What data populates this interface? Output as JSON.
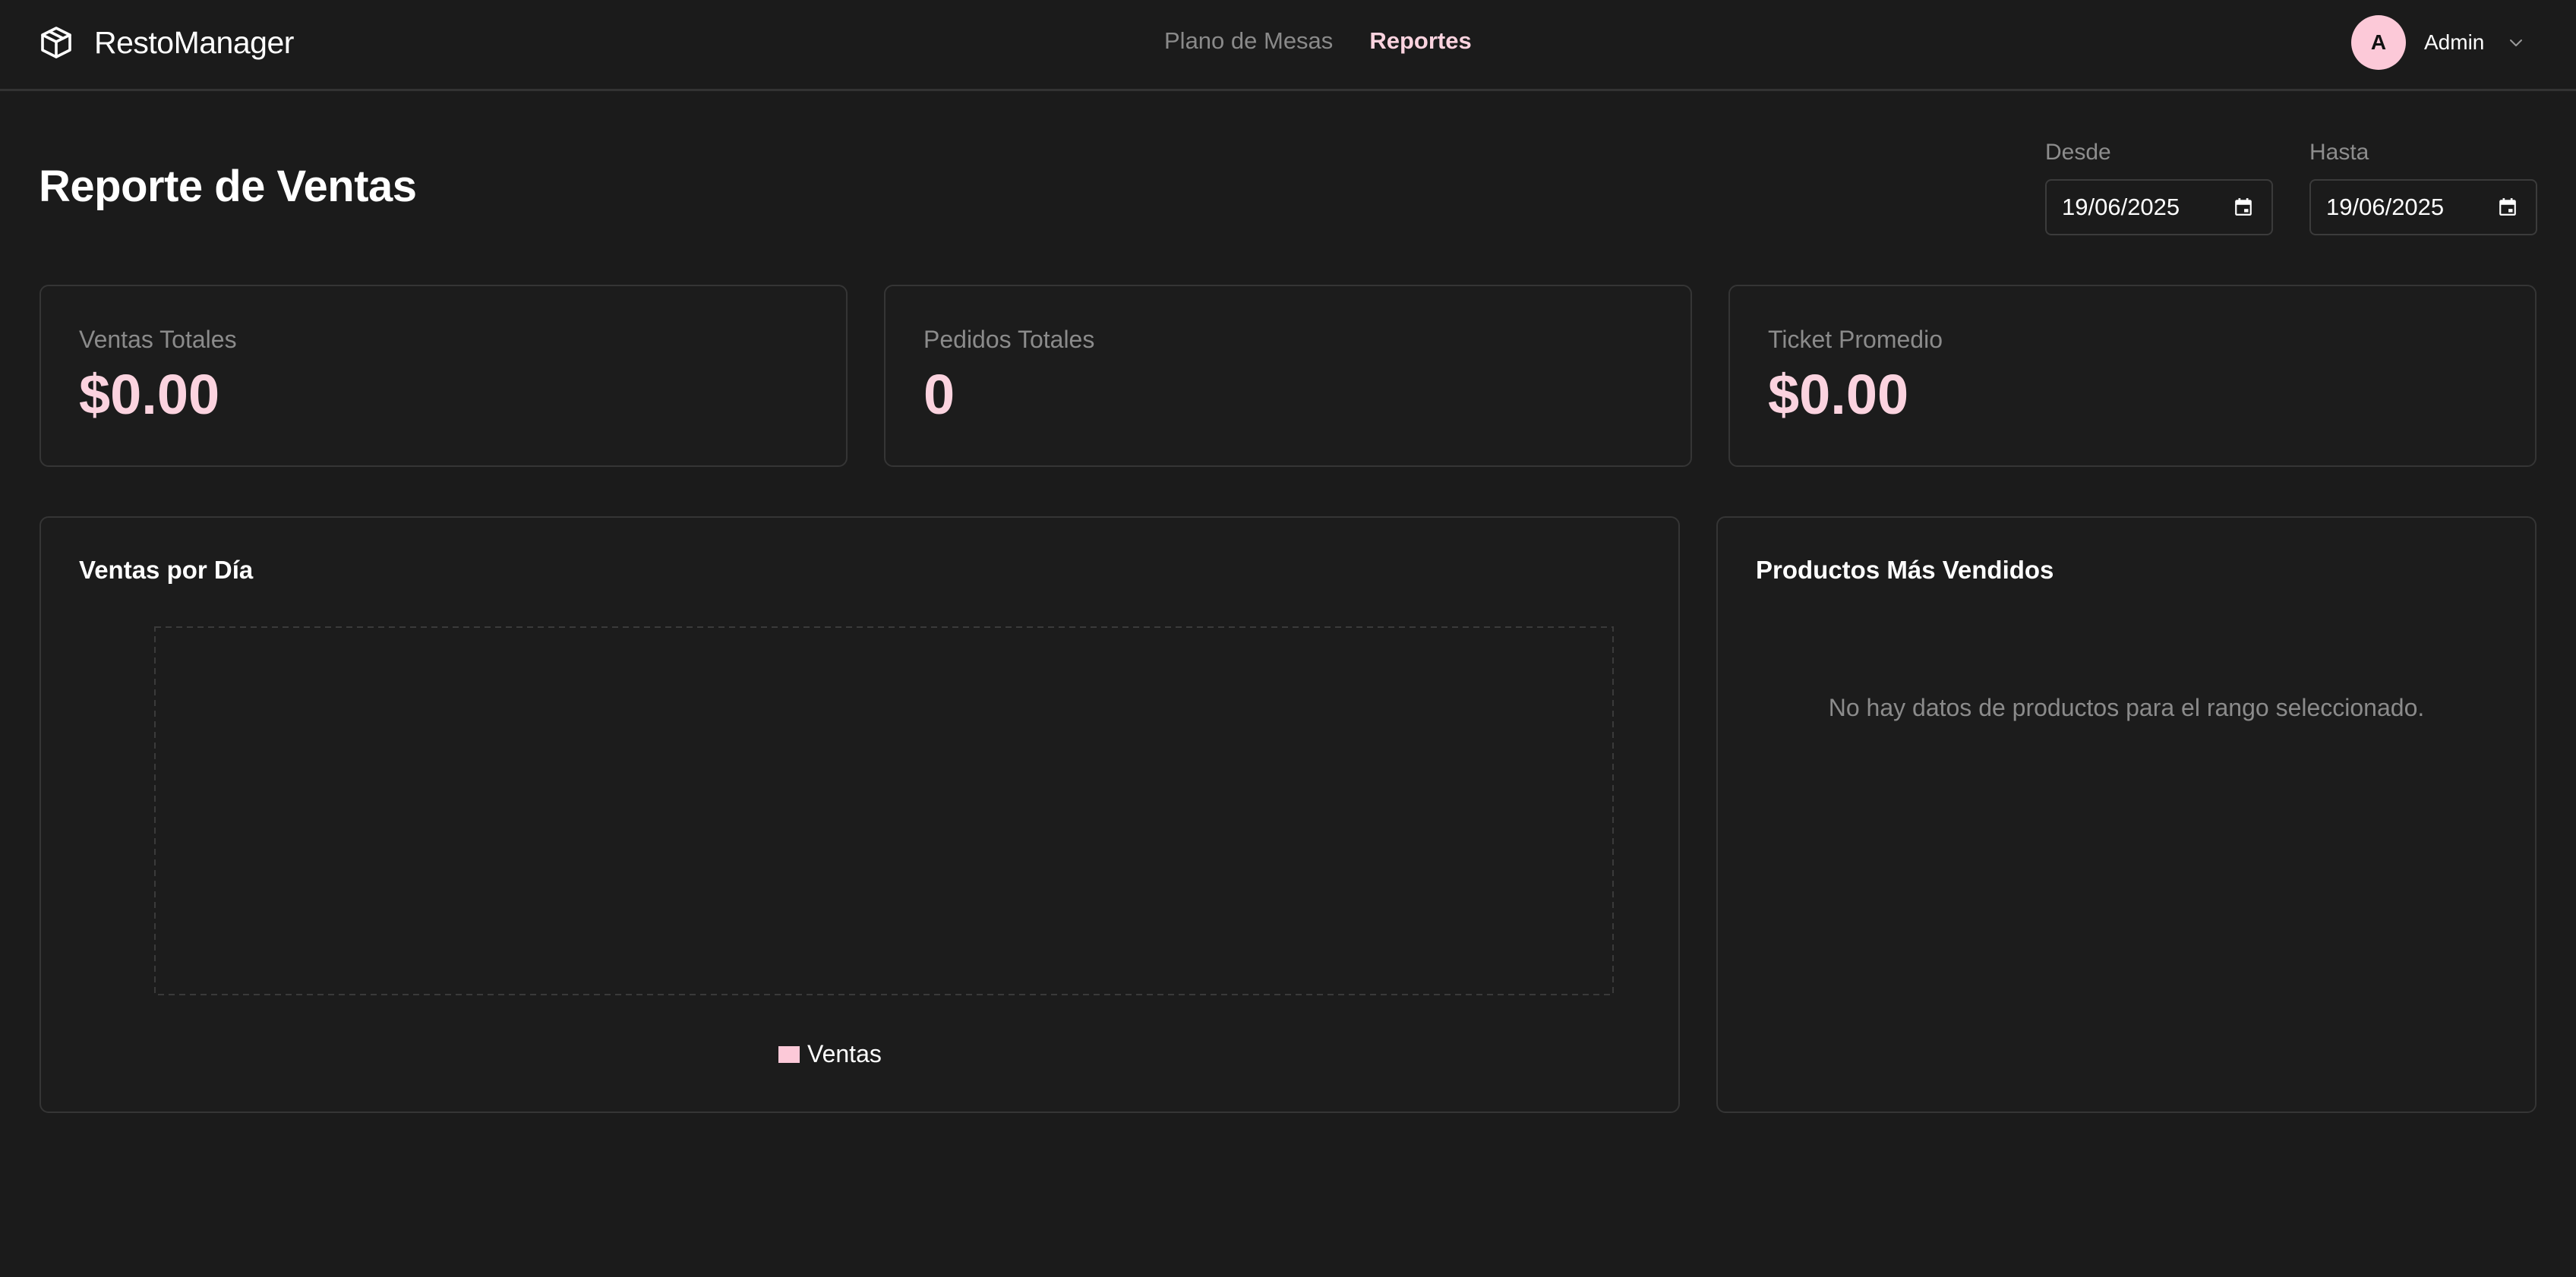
{
  "app": {
    "name": "RestoManager"
  },
  "nav": {
    "items": [
      {
        "label": "Plano de Mesas",
        "active": false
      },
      {
        "label": "Reportes",
        "active": true
      }
    ]
  },
  "user": {
    "initial": "A",
    "name": "Admin"
  },
  "page": {
    "title": "Reporte de Ventas"
  },
  "filters": {
    "from": {
      "label": "Desde",
      "value": "19/06/2025"
    },
    "to": {
      "label": "Hasta",
      "value": "19/06/2025"
    }
  },
  "stats": [
    {
      "label": "Ventas Totales",
      "value": "$0.00"
    },
    {
      "label": "Pedidos Totales",
      "value": "0"
    },
    {
      "label": "Ticket Promedio",
      "value": "$0.00"
    }
  ],
  "sales_chart": {
    "title": "Ventas por Día",
    "legend_label": "Ventas",
    "series_color": "#fcc9d8"
  },
  "chart_data": {
    "type": "bar",
    "title": "Ventas por Día",
    "categories": [],
    "series": [
      {
        "name": "Ventas",
        "values": []
      }
    ],
    "legend": "bottom",
    "grid": false
  },
  "top_products": {
    "title": "Productos Más Vendidos",
    "empty_message": "No hay datos de productos para el rango seleccionado."
  },
  "colors": {
    "accent": "#fbd3df",
    "background": "#1b1b1b",
    "border": "#353535",
    "muted": "#8b8b8b"
  }
}
